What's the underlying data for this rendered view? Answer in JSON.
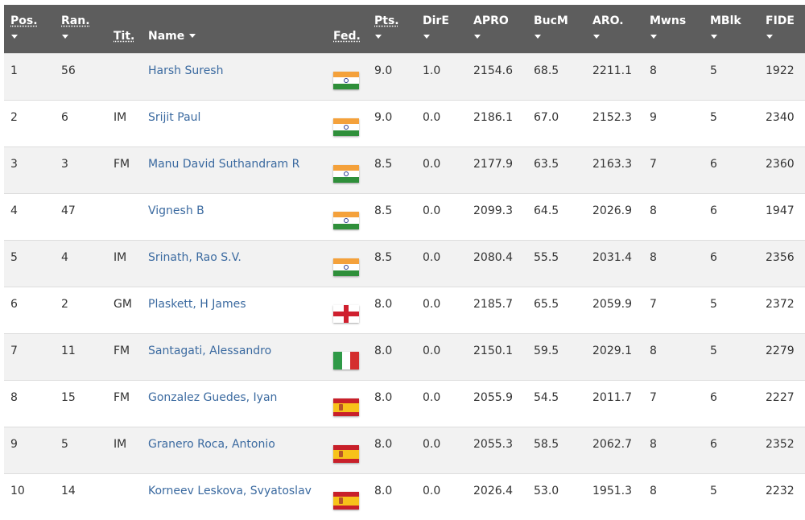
{
  "colors": {
    "header_bg": "#5d5d5d",
    "link": "#3b6aa0",
    "row_alt": "#f2f2f2"
  },
  "columns": [
    {
      "key": "pos",
      "label": "Pos.",
      "sortable": true
    },
    {
      "key": "rank",
      "label": "Ran.",
      "sortable": true
    },
    {
      "key": "title",
      "label": "Tit.",
      "sortable": false
    },
    {
      "key": "name",
      "label": "Name",
      "sortable": true
    },
    {
      "key": "fed",
      "label": "Fed.",
      "sortable": false
    },
    {
      "key": "pts",
      "label": "Pts.",
      "sortable": true
    },
    {
      "key": "dire",
      "label": "DirE",
      "sortable": true
    },
    {
      "key": "apro",
      "label": "APRO",
      "sortable": true
    },
    {
      "key": "bucm",
      "label": "BucM",
      "sortable": true
    },
    {
      "key": "aro",
      "label": "ARO.",
      "sortable": true
    },
    {
      "key": "mwns",
      "label": "Mwns",
      "sortable": true
    },
    {
      "key": "mblk",
      "label": "MBlk",
      "sortable": true
    },
    {
      "key": "fide",
      "label": "FIDE",
      "sortable": true
    }
  ],
  "rows": [
    {
      "pos": "1",
      "rank": "56",
      "title": "",
      "name": "Harsh Suresh",
      "fed": "india-flag-icon",
      "pts": "9.0",
      "dire": "1.0",
      "apro": "2154.6",
      "bucm": "68.5",
      "aro": "2211.1",
      "mwns": "8",
      "mblk": "5",
      "fide": "1922"
    },
    {
      "pos": "2",
      "rank": "6",
      "title": "IM",
      "name": "Srijit Paul",
      "fed": "india-flag-icon",
      "pts": "9.0",
      "dire": "0.0",
      "apro": "2186.1",
      "bucm": "67.0",
      "aro": "2152.3",
      "mwns": "9",
      "mblk": "5",
      "fide": "2340"
    },
    {
      "pos": "3",
      "rank": "3",
      "title": "FM",
      "name": "Manu David Suthandram R",
      "fed": "india-flag-icon",
      "pts": "8.5",
      "dire": "0.0",
      "apro": "2177.9",
      "bucm": "63.5",
      "aro": "2163.3",
      "mwns": "7",
      "mblk": "6",
      "fide": "2360"
    },
    {
      "pos": "4",
      "rank": "47",
      "title": "",
      "name": "Vignesh B",
      "fed": "india-flag-icon",
      "pts": "8.5",
      "dire": "0.0",
      "apro": "2099.3",
      "bucm": "64.5",
      "aro": "2026.9",
      "mwns": "8",
      "mblk": "6",
      "fide": "1947"
    },
    {
      "pos": "5",
      "rank": "4",
      "title": "IM",
      "name": "Srinath, Rao S.V.",
      "fed": "india-flag-icon",
      "pts": "8.5",
      "dire": "0.0",
      "apro": "2080.4",
      "bucm": "55.5",
      "aro": "2031.4",
      "mwns": "8",
      "mblk": "6",
      "fide": "2356"
    },
    {
      "pos": "6",
      "rank": "2",
      "title": "GM",
      "name": "Plaskett, H James",
      "fed": "england-flag-icon",
      "pts": "8.0",
      "dire": "0.0",
      "apro": "2185.7",
      "bucm": "65.5",
      "aro": "2059.9",
      "mwns": "7",
      "mblk": "5",
      "fide": "2372"
    },
    {
      "pos": "7",
      "rank": "11",
      "title": "FM",
      "name": "Santagati, Alessandro",
      "fed": "italy-flag-icon",
      "pts": "8.0",
      "dire": "0.0",
      "apro": "2150.1",
      "bucm": "59.5",
      "aro": "2029.1",
      "mwns": "8",
      "mblk": "5",
      "fide": "2279"
    },
    {
      "pos": "8",
      "rank": "15",
      "title": "FM",
      "name": "Gonzalez Guedes, Iyan",
      "fed": "spain-flag-icon",
      "pts": "8.0",
      "dire": "0.0",
      "apro": "2055.9",
      "bucm": "54.5",
      "aro": "2011.7",
      "mwns": "7",
      "mblk": "6",
      "fide": "2227"
    },
    {
      "pos": "9",
      "rank": "5",
      "title": "IM",
      "name": "Granero Roca, Antonio",
      "fed": "spain-flag-icon",
      "pts": "8.0",
      "dire": "0.0",
      "apro": "2055.3",
      "bucm": "58.5",
      "aro": "2062.7",
      "mwns": "8",
      "mblk": "6",
      "fide": "2352"
    },
    {
      "pos": "10",
      "rank": "14",
      "title": "",
      "name": "Korneev Leskova, Svyatoslav",
      "fed": "spain-flag-icon",
      "pts": "8.0",
      "dire": "0.0",
      "apro": "2026.4",
      "bucm": "53.0",
      "aro": "1951.3",
      "mwns": "8",
      "mblk": "5",
      "fide": "2232"
    }
  ]
}
